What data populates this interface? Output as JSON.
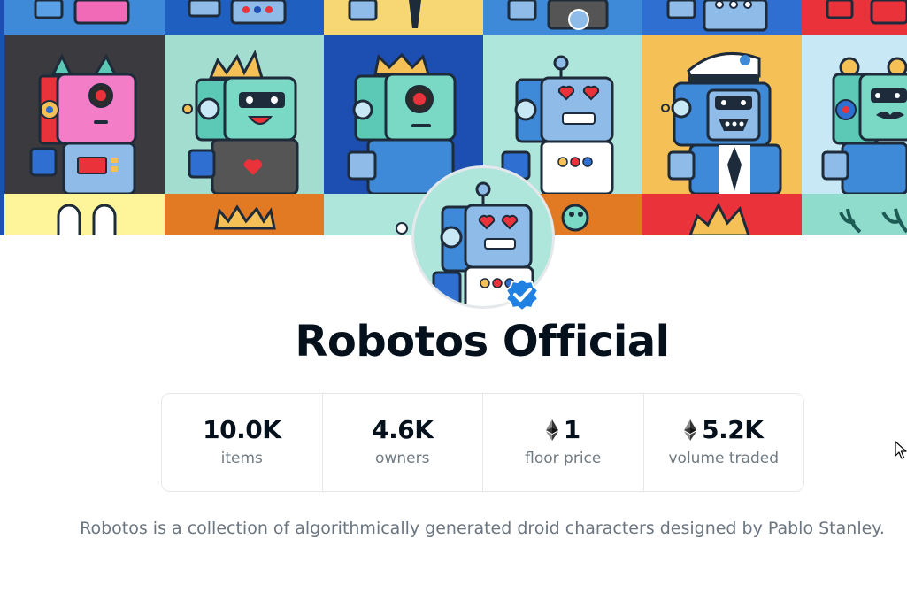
{
  "collection": {
    "name": "Robotos Official",
    "verified": true,
    "description": "Robotos is a collection of algorithmically generated droid characters designed by Pablo Stanley."
  },
  "stats": [
    {
      "value": "10.0K",
      "label": "items",
      "eth": false
    },
    {
      "value": "4.6K",
      "label": "owners",
      "eth": false
    },
    {
      "value": "1",
      "label": "floor price",
      "eth": true
    },
    {
      "value": "5.2K",
      "label": "volume traded",
      "eth": true
    }
  ],
  "icons": {
    "verified": "verified-badge-icon",
    "currency": "ethereum-icon",
    "cursor": "mouse-pointer-icon"
  },
  "colors": {
    "verified_blue": "#2081e2",
    "title": "#04111d",
    "muted": "#707a83",
    "border": "#e5e8eb"
  }
}
